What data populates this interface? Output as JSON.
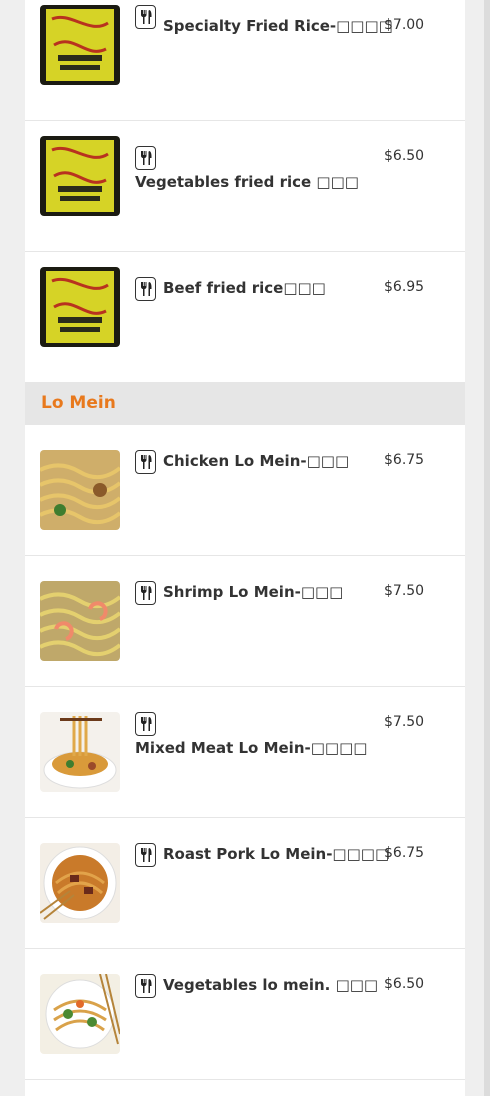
{
  "colors": {
    "accent": "#e8791d",
    "text": "#333333",
    "section_bg": "#e6e6e6",
    "page_bg": "#efefef"
  },
  "icons": {
    "dish": "utensils-icon"
  },
  "fried_rice": [
    {
      "name": "Specialty Fried Rice-□□□□",
      "price": "$7.00",
      "image": "restaurant-logo"
    },
    {
      "name": "Vegetables fried rice □□□",
      "price": "$6.50",
      "image": "restaurant-logo"
    },
    {
      "name": "Beef fried rice□□□",
      "price": "$6.95",
      "image": "restaurant-logo"
    }
  ],
  "lo_mein_section": {
    "title": "Lo Mein",
    "items": [
      {
        "name": "Chicken Lo Mein-□□□",
        "price": "$6.75",
        "image": "noodles-chicken"
      },
      {
        "name": "Shrimp Lo Mein-□□□",
        "price": "$7.50",
        "image": "noodles-shrimp"
      },
      {
        "name": "Mixed Meat Lo Mein-□□□□",
        "price": "$7.50",
        "image": "noodles-bowl"
      },
      {
        "name": "Roast Pork Lo Mein-□□□□",
        "price": "$6.75",
        "image": "noodles-pork"
      },
      {
        "name": "Vegetables lo mein. □□□",
        "price": "$6.50",
        "image": "noodles-vegetable"
      }
    ]
  }
}
